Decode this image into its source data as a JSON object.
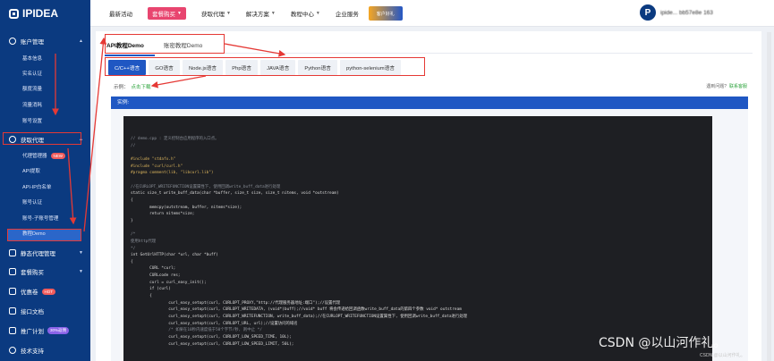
{
  "brand": {
    "name": "IPIDEA"
  },
  "topnav": {
    "items": [
      "最新活动",
      "套餐购买",
      "获取代理",
      "解决方案",
      "教程中心",
      "企业服务"
    ],
    "promo": "客户好礼"
  },
  "user": {
    "avatar_letter": "P",
    "name": "ipide... bb57e8e 163"
  },
  "sidebar": {
    "account_group": "账户管理",
    "account_items": [
      "基本信息",
      "实名认证",
      "额度流量",
      "流量消耗",
      "账号设置"
    ],
    "proxy_group": "获取代理",
    "proxy_items": [
      "代理管理器",
      "API提取",
      "API-IP白名单",
      "账号认证",
      "账号-子账号管理",
      "教程Demo"
    ],
    "proxy_new_tag": "NEW",
    "static_group": "静态代理管理",
    "buy_group": "套餐购买",
    "coupon_group": "优惠卷",
    "coupon_tag": "HOT",
    "api_doc_group": "接口文档",
    "referral_group": "推广计划",
    "referral_tag": "30%返佣",
    "support_group": "技术支持"
  },
  "main": {
    "tabs": [
      "API教程Demo",
      "账密教程Demo"
    ],
    "langs": [
      "C/C++语言",
      "GO语言",
      "Node.js语言",
      "Php语言",
      "JAVA语言",
      "Python语言",
      "python-selenium语言"
    ],
    "sample_label": "示例：",
    "sample_link": "点击下载",
    "help_text": "遇到问题?",
    "help_link": "联系客服",
    "example_title": "实例:"
  },
  "code_lines": [
    "// demo.cpp : 定义控制台应用程序的入口点。",
    "//",
    "",
    "#include \"stdafx.h\"",
    "#include \"curl/curl.h\"",
    "#pragma comment(lib, \"libcurl.lib\")",
    "",
    "//在CURLOPT_WRITEFUNCTION设置属性下, 使用回调write_buff_data进行处理",
    "static size_t write_buff_data(char *buffer, size_t size, size_t nitems, void *outstream)",
    "{",
    "        memcpy(outstream, buffer, nitems*size);",
    "        return nitems*size;",
    "}",
    "",
    "/*",
    "使用http代理",
    "*/",
    "int GetUrlHTTP(char *url, char *buff)",
    "{",
    "        CURL *curl;",
    "        CURLcode res;",
    "        curl = curl_easy_init();",
    "        if (curl)",
    "        {",
    "                curl_easy_setopt(curl, CURLOPT_PROXY,\"http://代理服务器地址:端口\");//设置代理",
    "                curl_easy_setopt(curl, CURLOPT_WRITEDATA, (void*)buff);//void* buff 将会传递给回调函数write_buff_data的第四个参数 void* outstream",
    "                curl_easy_setopt(curl, CURLOPT_WRITEFUNCTION, write_buff_data);//在CURLOPT_WRITEFUNCTION设置属性下, 使用回调write_buff_data进行处理",
    "                curl_easy_setopt(curl, CURLOPT_URL, url);//设置访问的域名",
    "                /* 如果在10秒内速度低于50个字节/秒, 则中止 */",
    "                curl_easy_setopt(curl, CURLOPT_LOW_SPEED_TIME, 10L);",
    "                curl_easy_setopt(curl, CURLOPT_LOW_SPEED_LIMIT, 50L);"
  ],
  "watermark": {
    "text": "CSDN @以山河作礼。",
    "small": "CSDN @以山河作礼。"
  },
  "colors": {
    "sidebar": "#0b3a80",
    "accent": "#1f57c3",
    "annotation": "#e53935",
    "link": "#2ca33c"
  }
}
